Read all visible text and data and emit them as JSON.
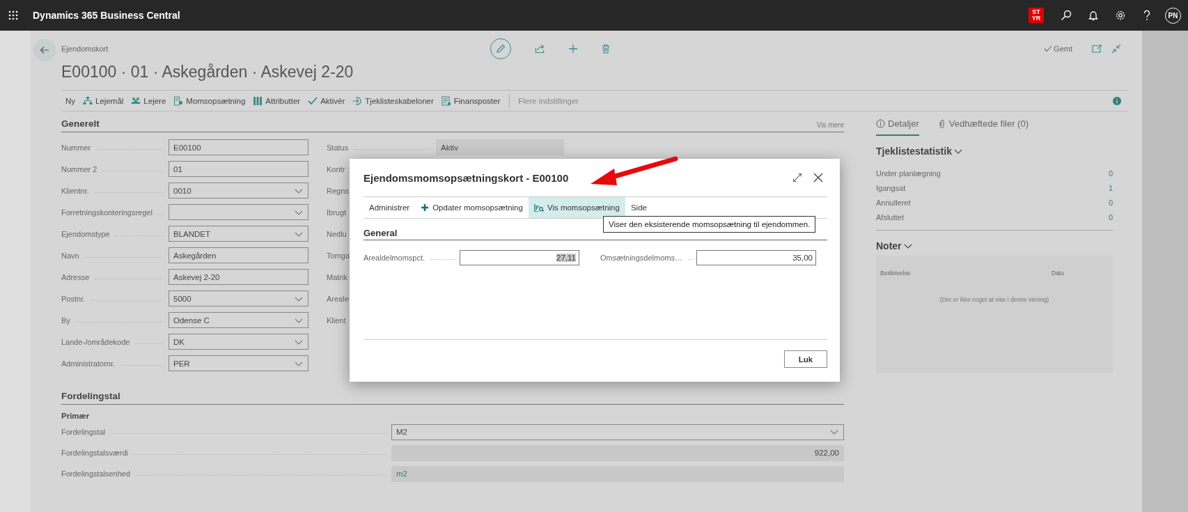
{
  "top_bar": {
    "app_title": "Dynamics 365 Business Central",
    "company_badge": [
      "ST",
      "YR"
    ],
    "avatar_initials": "PN"
  },
  "page": {
    "breadcrumb": "Ejendomskort",
    "title": "E00100 · 01 · Askegården · Askevej 2-20",
    "save_status": "Gemt"
  },
  "actions": [
    {
      "label": "Ny"
    },
    {
      "label": "Lejemål"
    },
    {
      "label": "Lejere"
    },
    {
      "label": "Momsopsætning"
    },
    {
      "label": "Attributter"
    },
    {
      "label": "Aktivér"
    },
    {
      "label": "Tjeklisteskabeloner"
    },
    {
      "label": "Finansposter"
    }
  ],
  "more_actions": "Flere indstillinger",
  "general": {
    "heading": "Generelt",
    "show_more": "Vis mere",
    "fields": [
      {
        "label": "Nummer",
        "value": "E00100",
        "kind": "text"
      },
      {
        "label": "Nummer 2",
        "value": "01",
        "kind": "text"
      },
      {
        "label": "Klientnr.",
        "value": "0010",
        "kind": "dropdown"
      },
      {
        "label": "Forretningskonteringsregel",
        "kind": "dropdown"
      },
      {
        "label": "Ejendomstype",
        "value": "BLANDET",
        "kind": "dropdown"
      },
      {
        "label": "Navn",
        "value": "Askegården",
        "kind": "text"
      },
      {
        "label": "Adresse",
        "value": "Askevej 2-20",
        "kind": "text"
      },
      {
        "label": "Postnr.",
        "value": "5000",
        "kind": "dropdown"
      },
      {
        "label": "By",
        "value": "Odense C",
        "kind": "dropdown"
      },
      {
        "label": "Lande-/områdekode",
        "value": "DK",
        "kind": "dropdown"
      },
      {
        "label": "Administratornr.",
        "value": "PER",
        "kind": "dropdown"
      }
    ],
    "fields_column_2": [
      {
        "label": "Status",
        "value": "Aktiv"
      },
      {
        "label": "Kontr"
      },
      {
        "label": "Regns"
      },
      {
        "label": "Ibrugt"
      },
      {
        "label": "Nedlu"
      },
      {
        "label": "Tomga"
      },
      {
        "label": "Matrik"
      },
      {
        "label": "Areale"
      },
      {
        "label": "Klient"
      }
    ]
  },
  "distribution": {
    "heading": "Fordelingstal",
    "subheading": "Primær",
    "fields": [
      {
        "label": "Fordelingstal",
        "value": "M2",
        "kind": "dropdown"
      },
      {
        "label": "Fordelingstalsværdi",
        "value": "922,00",
        "kind": "number"
      },
      {
        "label": "Fordelingstalsenhed",
        "value": "m2",
        "kind": "link"
      }
    ]
  },
  "factbox": {
    "tabs": [
      {
        "label": "Detaljer",
        "selected": true
      },
      {
        "label": "Vedhæftede filer (0)",
        "selected": false
      }
    ],
    "stats": {
      "heading": "Tjeklistestatistik",
      "rows": [
        {
          "label": "Under planlægning",
          "value": "0"
        },
        {
          "label": "Igangsat",
          "value": "1"
        },
        {
          "label": "Annulleret",
          "value": "0"
        },
        {
          "label": "Afsluttet",
          "value": "0"
        }
      ]
    },
    "notes": {
      "heading": "Noter",
      "columns": [
        "Beskrivelse",
        "Dato"
      ],
      "empty_text": "(Der er ikke noget at vise i denne visning)"
    }
  },
  "dialog": {
    "title": "Ejendomsmomsopsætningskort - E00100",
    "actions": [
      {
        "label": "Administrer",
        "selected": false
      },
      {
        "label": "Opdater momsopsætning",
        "selected": false
      },
      {
        "label": "Vis momsopsætning",
        "selected": true
      },
      {
        "label": "Side",
        "selected": false
      }
    ],
    "tooltip": "Viser den eksisterende momsopsætning til ejendommen.",
    "section": "General",
    "fields": [
      {
        "label": "Arealdelmomspct.",
        "value": "27,11",
        "selected": true
      },
      {
        "label": "Omsætningsdelmoms…",
        "value": "35,00",
        "selected": false
      }
    ],
    "close_button": "Luk"
  }
}
